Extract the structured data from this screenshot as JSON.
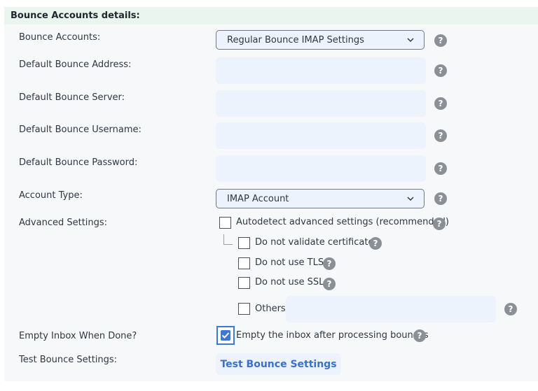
{
  "section": {
    "title": "Bounce Accounts details:"
  },
  "fields": {
    "bounce_accounts": {
      "label": "Bounce Accounts:",
      "value": "Regular Bounce IMAP Settings"
    },
    "default_bounce_address": {
      "label": "Default Bounce Address:",
      "value": ""
    },
    "default_bounce_server": {
      "label": "Default Bounce Server:",
      "value": ""
    },
    "default_bounce_username": {
      "label": "Default Bounce Username:",
      "value": ""
    },
    "default_bounce_password": {
      "label": "Default Bounce Password:",
      "value": ""
    },
    "account_type": {
      "label": "Account Type:",
      "value": "IMAP Account"
    },
    "advanced_settings": {
      "label": "Advanced Settings:",
      "autodetect": "Autodetect advanced settings (recommended)",
      "no_validate_cert": "Do not validate certificate",
      "no_tls": "Do not use TLS",
      "no_ssl": "Do not use SSL",
      "others": "Others",
      "others_value": ""
    },
    "empty_inbox": {
      "label": "Empty Inbox When Done?",
      "option": "Empty the inbox after processing bounces",
      "checked": true
    },
    "test_bounce": {
      "label": "Test Bounce Settings:",
      "button": "Test Bounce Settings"
    }
  },
  "help_glyph": "?",
  "icons": {
    "help": "question-circle-icon",
    "dropdown": "chevron-down-icon",
    "check": "checkmark-icon"
  },
  "colors": {
    "accent": "#3f78d2",
    "header_bg": "#e9f5ee",
    "input_bg": "#edf3fd",
    "help_bg": "#8b9097"
  }
}
